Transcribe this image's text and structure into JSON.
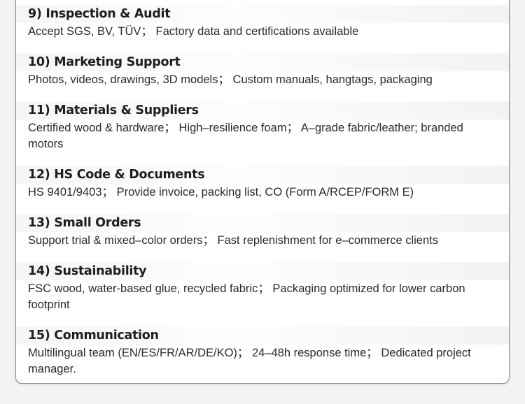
{
  "sections": [
    {
      "title": "9) Inspection & Audit",
      "body": "Accept SGS, BV, TÜV； Factory data and certifications available"
    },
    {
      "title": "10) Marketing Support",
      "body": "Photos, videos, drawings, 3D models； Custom manuals, hangtags, packaging"
    },
    {
      "title": "11) Materials & Suppliers",
      "body": "Certified wood & hardware； High–resilience foam； A–grade fabric/leather; branded motors"
    },
    {
      "title": "12) HS Code & Documents",
      "body": "HS 9401/9403； Provide invoice, packing list, CO (Form A/RCEP/FORM E)"
    },
    {
      "title": "13) Small Orders",
      "body": "Support trial & mixed–color orders； Fast replenishment for e–commerce clients"
    },
    {
      "title": "14) Sustainability",
      "body": "FSC wood, water-based glue, recycled fabric； Packaging optimized for lower carbon footprint"
    },
    {
      "title": "15) Communication",
      "body": "Multilingual team (EN/ES/FR/AR/DE/KO)； 24–48h response time； Dedicated project manager."
    }
  ]
}
